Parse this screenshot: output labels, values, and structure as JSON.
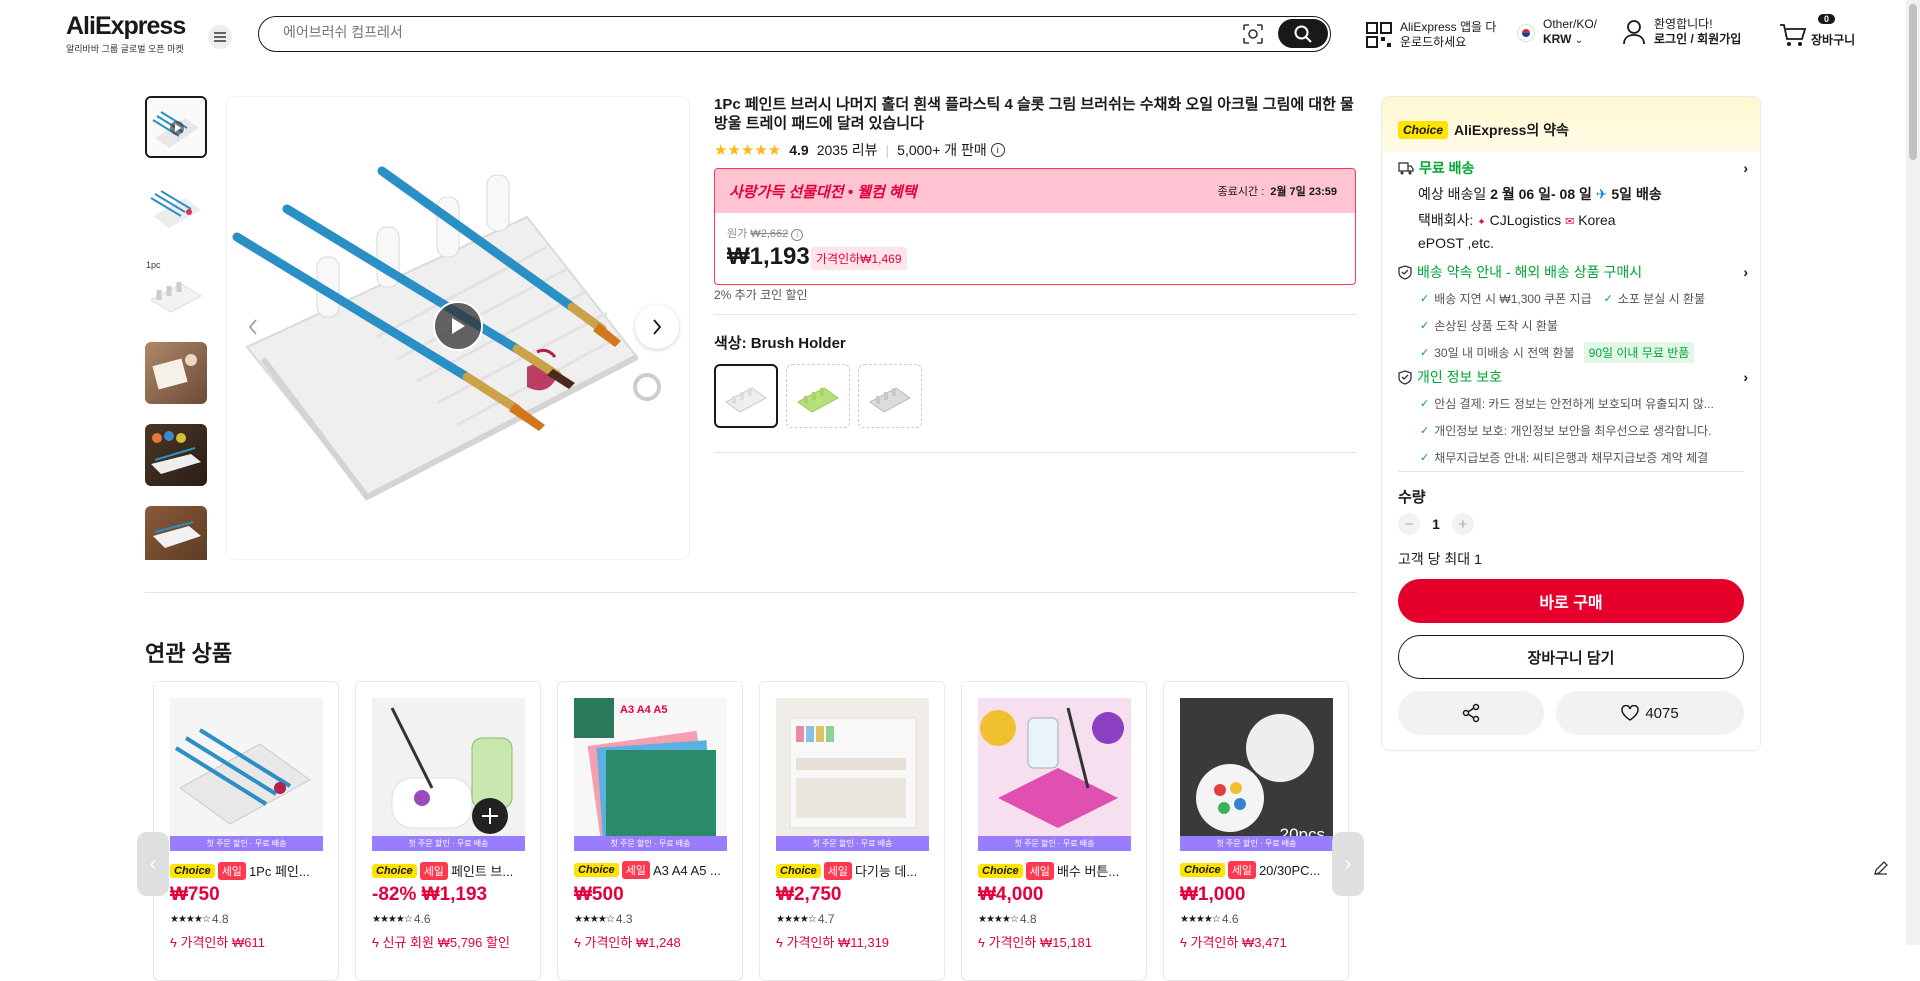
{
  "header": {
    "logo": "AliExpress",
    "logo_sub": "알리바바 그룹 글로벌 오픈 마켓",
    "search_placeholder": "에어브러쉬 컴프레서",
    "app_line1": "AliExpress 앱을 다",
    "app_line2": "운로드하세요",
    "region_line1": "Other/KO/",
    "region_line2": "KRW",
    "account_line1": "환영합니다!",
    "account_line2": "로그인 / 회원가입",
    "cart_count": "0",
    "cart_label": "장바구니"
  },
  "gallery": {
    "thumb3_label": "1pc"
  },
  "product": {
    "title": "1Pc 페인트 브러시 나머지 홀더 흰색 플라스틱 4 슬롯 그림 브러쉬는 수채화 오일 아크릴 그림에 대한 물방울 트레이 패드에 달려 있습니다",
    "rating": "4.9",
    "reviews": "2035 리뷰",
    "sold": "5,000+ 개 판매",
    "promo_brand": "사랑가득 선물대전",
    "promo_suffix": " • 웰컴 혜택",
    "end_label": "종료시간 :",
    "end_time": "2월 7일 23:59",
    "orig_label": "원가",
    "orig_price": "₩2,662",
    "price": "₩1,193",
    "discount_tag": "가격인하₩1,469",
    "coin": "2% 추가 코인 할인",
    "color_label": "색상: Brush Holder"
  },
  "panel": {
    "choice": "Choice",
    "promise": "AliExpress의 약속",
    "free_ship": "무료 배송",
    "delivery_pre": "예상 배송일 ",
    "delivery_dates": "2 월 06 일- 08 일",
    "delivery_days": "5일 배송",
    "carrier_label": "택배회사: ",
    "carrier1": "CJLogistics",
    "carrier2": "Korea",
    "carrier3": "ePOST ,etc.",
    "guarantee_title": "배송 약속 안내 - 해외 배송 상품 구매시",
    "g1": "배송 지연 시 ₩1,300 쿠폰 지급",
    "g2": "소포 분실 시 환불",
    "g3": "손상된 상품 도착 시 환불",
    "g4": "30일 내 미배송 시 전액 환불",
    "g4_tag": "90일 이내 무료 반품",
    "privacy_title": "개인 정보 보호",
    "p1": "안심 결제: 카드 정보는 안전하게 보호되며 유출되지 않...",
    "p2": "개인정보 보호: 개인정보 보안을 최우선으로 생각합니다.",
    "p3": "채무지급보증 안내: 씨티은행과 채무지급보증 계약 체결",
    "qty_label": "수량",
    "qty": "1",
    "limit": "고객 당 최대 1",
    "buy_now": "바로 구매",
    "add_cart": "장바구니 담기",
    "wishlist_count": "4075"
  },
  "related": {
    "title": "연관 상품",
    "strip": "첫 주문 할인 · 무료 배송",
    "choice": "Choice",
    "sale": "세일",
    "items": [
      {
        "name": "1Pc 페인...",
        "price": "₩750",
        "rating": "4.8",
        "deal": "가격인하 ₩611",
        "dealColor": "#e4003a"
      },
      {
        "name": "페인트 브...",
        "price": "-82% ₩1,193",
        "rating": "4.6",
        "deal": "신규 회원 ₩5,796 할인",
        "dealColor": "#e4003a"
      },
      {
        "name": "A3 A4 A5 ...",
        "price": "₩500",
        "rating": "4.3",
        "deal": "가격인하 ₩1,248",
        "dealColor": "#e4003a"
      },
      {
        "name": "다기능 데...",
        "price": "₩2,750",
        "rating": "4.7",
        "deal": "가격인하 ₩11,319",
        "dealColor": "#e4003a"
      },
      {
        "name": "배수 버튼...",
        "price": "₩4,000",
        "rating": "4.8",
        "deal": "가격인하 ₩15,181",
        "dealColor": "#e4003a"
      },
      {
        "name": "20/30PC...",
        "price": "₩1,000",
        "rating": "4.6",
        "deal": "가격인하 ₩3,471",
        "dealColor": "#e4003a"
      }
    ],
    "img3_text": "A3 A4 A5",
    "img6_text": "20pcs"
  }
}
